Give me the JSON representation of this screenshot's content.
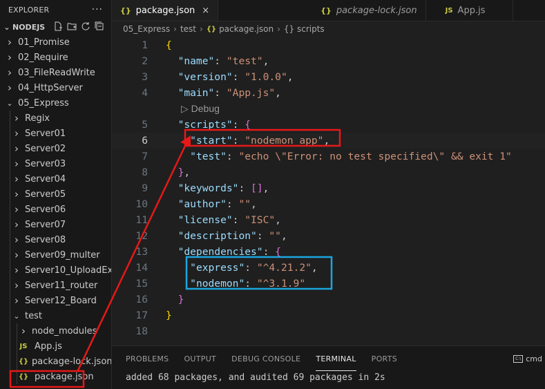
{
  "explorer": {
    "title": "EXPLORER",
    "more_icon": "ellipsis-icon",
    "section": "NODEJS",
    "actions": [
      "new-file-icon",
      "new-folder-icon",
      "refresh-icon",
      "collapse-all-icon"
    ],
    "items": [
      {
        "label": "01_Promise",
        "kind": "folder",
        "expanded": false
      },
      {
        "label": "02_Require",
        "kind": "folder",
        "expanded": false
      },
      {
        "label": "03_FileReadWrite",
        "kind": "folder",
        "expanded": false
      },
      {
        "label": "04_HttpServer",
        "kind": "folder",
        "expanded": false
      },
      {
        "label": "05_Express",
        "kind": "folder",
        "expanded": true
      },
      {
        "label": "Regix",
        "kind": "folder",
        "expanded": false
      },
      {
        "label": "Server01",
        "kind": "folder",
        "expanded": false
      },
      {
        "label": "Server02",
        "kind": "folder",
        "expanded": false
      },
      {
        "label": "Server03",
        "kind": "folder",
        "expanded": false
      },
      {
        "label": "Server04",
        "kind": "folder",
        "expanded": false
      },
      {
        "label": "Server05",
        "kind": "folder",
        "expanded": false
      },
      {
        "label": "Server06",
        "kind": "folder",
        "expanded": false
      },
      {
        "label": "Server07",
        "kind": "folder",
        "expanded": false
      },
      {
        "label": "Server08",
        "kind": "folder",
        "expanded": false
      },
      {
        "label": "Server09_multer",
        "kind": "folder",
        "expanded": false
      },
      {
        "label": "Server10_UploadEx",
        "kind": "folder",
        "expanded": false
      },
      {
        "label": "Server11_router",
        "kind": "folder",
        "expanded": false
      },
      {
        "label": "Server12_Board",
        "kind": "folder",
        "expanded": false
      },
      {
        "label": "test",
        "kind": "folder",
        "expanded": true
      },
      {
        "label": "node_modules",
        "kind": "folder",
        "expanded": false
      },
      {
        "label": "App.js",
        "kind": "js",
        "icon_text": "JS"
      },
      {
        "label": "package-lock.json",
        "kind": "json",
        "icon_text": "{}"
      },
      {
        "label": "package.json",
        "kind": "json",
        "icon_text": "{}"
      }
    ]
  },
  "tabs": [
    {
      "label": "package.json",
      "icon_text": "{}",
      "active": true,
      "italic": false,
      "close": "×"
    },
    {
      "label": "package-lock.json",
      "icon_text": "{}",
      "active": false,
      "italic": true
    },
    {
      "label": "App.js",
      "icon_text": "JS",
      "active": false,
      "italic": false
    }
  ],
  "breadcrumb": {
    "parts": [
      "05_Express",
      "test"
    ],
    "file": "package.json",
    "file_icon": "{}",
    "symbol": "{} scripts",
    "separator": "›"
  },
  "editor": {
    "current_line": 6,
    "codelens": "▷ Debug",
    "lines": [
      {
        "n": "1",
        "tokens": [
          [
            "{",
            "t-brace1"
          ]
        ]
      },
      {
        "n": "2",
        "tokens": [
          [
            "  ",
            ""
          ],
          [
            "\"name\"",
            "t-key"
          ],
          [
            ": ",
            "t-punct"
          ],
          [
            "\"test\"",
            "t-str"
          ],
          [
            ",",
            "t-punct"
          ]
        ]
      },
      {
        "n": "3",
        "tokens": [
          [
            "  ",
            ""
          ],
          [
            "\"version\"",
            "t-key"
          ],
          [
            ": ",
            "t-punct"
          ],
          [
            "\"1.0.0\"",
            "t-str"
          ],
          [
            ",",
            "t-punct"
          ]
        ]
      },
      {
        "n": "4",
        "tokens": [
          [
            "  ",
            ""
          ],
          [
            "\"main\"",
            "t-key"
          ],
          [
            ": ",
            "t-punct"
          ],
          [
            "\"App.js\"",
            "t-str"
          ],
          [
            ",",
            "t-punct"
          ]
        ]
      },
      {
        "n": "",
        "codelens": true
      },
      {
        "n": "5",
        "tokens": [
          [
            "  ",
            ""
          ],
          [
            "\"scripts\"",
            "t-key"
          ],
          [
            ": ",
            "t-punct"
          ],
          [
            "{",
            "t-brace2"
          ]
        ]
      },
      {
        "n": "6",
        "tokens": [
          [
            "    ",
            ""
          ],
          [
            "\"start\"",
            "t-key"
          ],
          [
            ": ",
            "t-punct"
          ],
          [
            "\"nodemon app\"",
            "t-str"
          ],
          [
            ",",
            "t-punct"
          ]
        ]
      },
      {
        "n": "7",
        "tokens": [
          [
            "    ",
            ""
          ],
          [
            "\"test\"",
            "t-key"
          ],
          [
            ": ",
            "t-punct"
          ],
          [
            "\"echo \\\"Error: no test specified\\\" && exit 1\"",
            "t-str"
          ]
        ]
      },
      {
        "n": "8",
        "tokens": [
          [
            "  ",
            ""
          ],
          [
            "}",
            "t-brace2"
          ],
          [
            ",",
            "t-punct"
          ]
        ]
      },
      {
        "n": "9",
        "tokens": [
          [
            "  ",
            ""
          ],
          [
            "\"keywords\"",
            "t-key"
          ],
          [
            ": ",
            "t-punct"
          ],
          [
            "[]",
            "t-brace2"
          ],
          [
            ",",
            "t-punct"
          ]
        ]
      },
      {
        "n": "10",
        "tokens": [
          [
            "  ",
            ""
          ],
          [
            "\"author\"",
            "t-key"
          ],
          [
            ": ",
            "t-punct"
          ],
          [
            "\"\"",
            "t-str"
          ],
          [
            ",",
            "t-punct"
          ]
        ]
      },
      {
        "n": "11",
        "tokens": [
          [
            "  ",
            ""
          ],
          [
            "\"license\"",
            "t-key"
          ],
          [
            ": ",
            "t-punct"
          ],
          [
            "\"ISC\"",
            "t-str"
          ],
          [
            ",",
            "t-punct"
          ]
        ]
      },
      {
        "n": "12",
        "tokens": [
          [
            "  ",
            ""
          ],
          [
            "\"description\"",
            "t-key"
          ],
          [
            ": ",
            "t-punct"
          ],
          [
            "\"\"",
            "t-str"
          ],
          [
            ",",
            "t-punct"
          ]
        ]
      },
      {
        "n": "13",
        "tokens": [
          [
            "  ",
            ""
          ],
          [
            "\"dependencies\"",
            "t-key"
          ],
          [
            ": ",
            "t-punct"
          ],
          [
            "{",
            "t-brace2"
          ]
        ]
      },
      {
        "n": "14",
        "tokens": [
          [
            "    ",
            ""
          ],
          [
            "\"express\"",
            "t-key"
          ],
          [
            ": ",
            "t-punct"
          ],
          [
            "\"^4.21.2\"",
            "t-str"
          ],
          [
            ",",
            "t-punct"
          ]
        ]
      },
      {
        "n": "15",
        "tokens": [
          [
            "    ",
            ""
          ],
          [
            "\"nodemon\"",
            "t-key"
          ],
          [
            ": ",
            "t-punct"
          ],
          [
            "\"^3.1.9\"",
            "t-str"
          ]
        ]
      },
      {
        "n": "16",
        "tokens": [
          [
            "  ",
            ""
          ],
          [
            "}",
            "t-brace2"
          ]
        ]
      },
      {
        "n": "17",
        "tokens": [
          [
            "}",
            "t-brace1"
          ]
        ]
      },
      {
        "n": "18",
        "tokens": []
      }
    ]
  },
  "panel": {
    "tabs": [
      "PROBLEMS",
      "OUTPUT",
      "DEBUG CONSOLE",
      "TERMINAL",
      "PORTS"
    ],
    "active": "TERMINAL",
    "shell_label": "cmd",
    "output": "added 68 packages, and audited 69 packages in 2s"
  },
  "annotations": {
    "red": "#e81818",
    "blue": "#1aa7e0"
  }
}
